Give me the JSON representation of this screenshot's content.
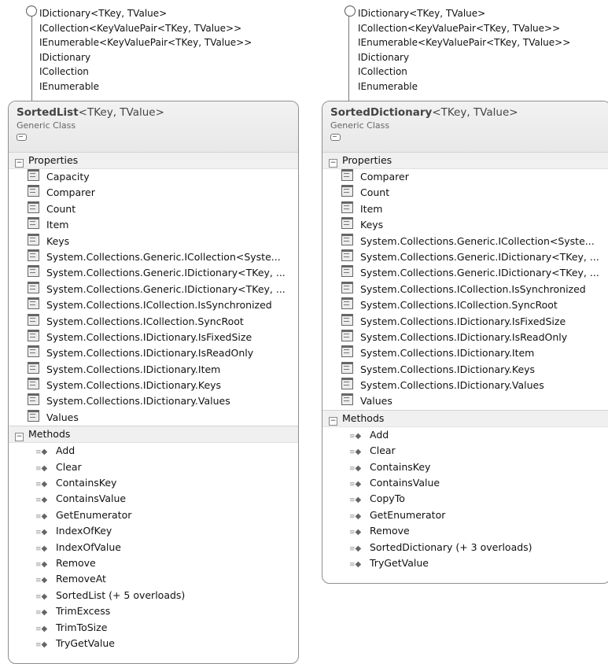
{
  "left": {
    "interfaces": [
      "IDictionary<TKey, TValue>",
      "ICollection<KeyValuePair<TKey, TValue>>",
      "IEnumerable<KeyValuePair<TKey, TValue>>",
      "IDictionary",
      "ICollection",
      "IEnumerable"
    ],
    "class_name": "SortedList",
    "generic_args": "<TKey, TValue>",
    "kind": "Generic Class",
    "properties_label": "Properties",
    "properties": [
      "Capacity",
      "Comparer",
      "Count",
      "Item",
      "Keys",
      "System.Collections.Generic.ICollection<Syste...",
      "System.Collections.Generic.IDictionary<TKey, ...",
      "System.Collections.Generic.IDictionary<TKey, ...",
      "System.Collections.ICollection.IsSynchronized",
      "System.Collections.ICollection.SyncRoot",
      "System.Collections.IDictionary.IsFixedSize",
      "System.Collections.IDictionary.IsReadOnly",
      "System.Collections.IDictionary.Item",
      "System.Collections.IDictionary.Keys",
      "System.Collections.IDictionary.Values",
      "Values"
    ],
    "methods_label": "Methods",
    "methods": [
      "Add",
      "Clear",
      "ContainsKey",
      "ContainsValue",
      "GetEnumerator",
      "IndexOfKey",
      "IndexOfValue",
      "Remove",
      "RemoveAt",
      "SortedList (+ 5 overloads)",
      "TrimExcess",
      "TrimToSize",
      "TryGetValue"
    ]
  },
  "right": {
    "interfaces": [
      "IDictionary<TKey, TValue>",
      "ICollection<KeyValuePair<TKey, TValue>>",
      "IEnumerable<KeyValuePair<TKey, TValue>>",
      "IDictionary",
      "ICollection",
      "IEnumerable"
    ],
    "class_name": "SortedDictionary",
    "generic_args": "<TKey, TValue>",
    "kind": "Generic Class",
    "properties_label": "Properties",
    "properties": [
      "Comparer",
      "Count",
      "Item",
      "Keys",
      "System.Collections.Generic.ICollection<Syste...",
      "System.Collections.Generic.IDictionary<TKey, ...",
      "System.Collections.Generic.IDictionary<TKey, ...",
      "System.Collections.ICollection.IsSynchronized",
      "System.Collections.ICollection.SyncRoot",
      "System.Collections.IDictionary.IsFixedSize",
      "System.Collections.IDictionary.IsReadOnly",
      "System.Collections.IDictionary.Item",
      "System.Collections.IDictionary.Keys",
      "System.Collections.IDictionary.Values",
      "Values"
    ],
    "methods_label": "Methods",
    "methods": [
      "Add",
      "Clear",
      "ContainsKey",
      "ContainsValue",
      "CopyTo",
      "GetEnumerator",
      "Remove",
      "SortedDictionary (+ 3 overloads)",
      "TryGetValue"
    ]
  },
  "icons": {
    "interface": "interface-lollipop-icon",
    "property": "property-icon",
    "method": "method-icon",
    "section_toggle": "minus-expander-icon",
    "collapse": "collapse-chevron-icon"
  }
}
